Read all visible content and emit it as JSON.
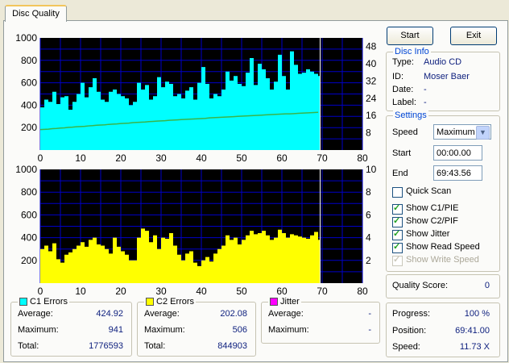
{
  "tab": {
    "label": "Disc Quality"
  },
  "buttons": {
    "start": "Start",
    "exit": "Exit"
  },
  "disc_info": {
    "title": "Disc Info",
    "rows": [
      {
        "label": "Type:",
        "value": "Audio CD"
      },
      {
        "label": "ID:",
        "value": "Moser Baer"
      },
      {
        "label": "Date:",
        "value": "-"
      },
      {
        "label": "Label:",
        "value": "-"
      }
    ]
  },
  "settings": {
    "title": "Settings",
    "speed_label": "Speed",
    "speed_value": "Maximum",
    "start_label": "Start",
    "start_value": "00:00.00",
    "end_label": "End",
    "end_value": "69:43.56",
    "quick_scan": "Quick Scan",
    "show_c1": "Show C1/PIE",
    "show_c2": "Show C2/PIF",
    "show_jitter": "Show Jitter",
    "show_read": "Show Read Speed",
    "show_write": "Show Write Speed"
  },
  "quality": {
    "label": "Quality Score:",
    "value": "0"
  },
  "progress": {
    "progress_label": "Progress:",
    "progress_value": "100 %",
    "position_label": "Position:",
    "position_value": "69:41.00",
    "speed_label": "Speed:",
    "speed_value": "11.73 X"
  },
  "c1": {
    "title": "C1 Errors",
    "avg_label": "Average:",
    "avg": "424.92",
    "max_label": "Maximum:",
    "max": "941",
    "total_label": "Total:",
    "total": "1776593"
  },
  "c2": {
    "title": "C2 Errors",
    "avg_label": "Average:",
    "avg": "202.08",
    "max_label": "Maximum:",
    "max": "506",
    "total_label": "Total:",
    "total": "844903"
  },
  "jitter": {
    "title": "Jitter",
    "avg_label": "Average:",
    "avg": "-",
    "max_label": "Maximum:",
    "max": "-"
  },
  "colors": {
    "c1": "#00ffff",
    "c2": "#ffff00",
    "jitter": "#ff00ff",
    "plot_bg": "#000000",
    "grid": "#0000c8",
    "read_speed": "#39b54a",
    "end_marker": "#ffffff"
  },
  "chart_data": [
    {
      "type": "area",
      "name": "C1 errors",
      "y_ticks_left": [
        "1000",
        "800",
        "600",
        "400",
        "200"
      ],
      "y_ticks_right": [
        "48",
        "40",
        "32",
        "24",
        "16",
        "8"
      ],
      "x_ticks": [
        "0",
        "10",
        "20",
        "30",
        "40",
        "50",
        "60",
        "70",
        "80"
      ],
      "xlim": [
        0,
        80
      ],
      "ylim": [
        0,
        1000
      ],
      "y2lim": [
        0,
        52
      ],
      "x": [
        0,
        1,
        2,
        3,
        4,
        5,
        6,
        7,
        8,
        9,
        10,
        11,
        12,
        13,
        14,
        15,
        16,
        17,
        18,
        19,
        20,
        21,
        22,
        23,
        24,
        25,
        26,
        27,
        28,
        29,
        30,
        31,
        32,
        33,
        34,
        35,
        36,
        37,
        38,
        39,
        40,
        41,
        42,
        43,
        44,
        45,
        46,
        47,
        48,
        49,
        50,
        51,
        52,
        53,
        54,
        55,
        56,
        57,
        58,
        59,
        60,
        61,
        62,
        63,
        64,
        65,
        66,
        67,
        68,
        69
      ],
      "c1_values": [
        380,
        450,
        430,
        520,
        410,
        470,
        480,
        360,
        430,
        500,
        600,
        470,
        560,
        640,
        520,
        450,
        430,
        520,
        540,
        500,
        480,
        460,
        400,
        430,
        600,
        540,
        580,
        450,
        480,
        650,
        560,
        610,
        590,
        480,
        500,
        460,
        530,
        560,
        450,
        600,
        740,
        590,
        460,
        500,
        480,
        540,
        700,
        620,
        660,
        590,
        570,
        690,
        820,
        580,
        770,
        720,
        640,
        540,
        610,
        850,
        660,
        540,
        880,
        760,
        680,
        690,
        720,
        700,
        680,
        660
      ],
      "read_speed": [
        9.5,
        9.6,
        9.7,
        9.9,
        10.0,
        10.2,
        10.3,
        10.5,
        10.6,
        10.8,
        10.9,
        11.0,
        11.2,
        11.3,
        11.5,
        11.6,
        11.7,
        11.9,
        12.0,
        12.1,
        12.3,
        12.4,
        12.5,
        12.7,
        12.8,
        12.9,
        13.0,
        13.2,
        13.3,
        13.4,
        13.5,
        13.6,
        13.8,
        13.9,
        14.0,
        14.1,
        14.2,
        14.3,
        14.4,
        14.5,
        14.6,
        14.7,
        14.9,
        15.0,
        15.1,
        15.2,
        15.3,
        15.4,
        15.5,
        15.6,
        15.7,
        15.8,
        15.9,
        16.0,
        16.1,
        16.2,
        16.3,
        16.4,
        16.5,
        16.6,
        16.7,
        16.8,
        16.8,
        16.9,
        17.0,
        17.1,
        17.2,
        17.3,
        17.4,
        17.5
      ]
    },
    {
      "type": "area",
      "name": "C2 errors",
      "y_ticks_left": [
        "1000",
        "800",
        "600",
        "400",
        "200"
      ],
      "y_ticks_right": [
        "10",
        "8",
        "6",
        "4",
        "2"
      ],
      "x_ticks": [
        "0",
        "10",
        "20",
        "30",
        "40",
        "50",
        "60",
        "70",
        "80"
      ],
      "xlim": [
        0,
        80
      ],
      "ylim": [
        0,
        1000
      ],
      "y2lim": [
        0,
        10
      ],
      "x": [
        0,
        1,
        2,
        3,
        4,
        5,
        6,
        7,
        8,
        9,
        10,
        11,
        12,
        13,
        14,
        15,
        16,
        17,
        18,
        19,
        20,
        21,
        22,
        23,
        24,
        25,
        26,
        27,
        28,
        29,
        30,
        31,
        32,
        33,
        34,
        35,
        36,
        37,
        38,
        39,
        40,
        41,
        42,
        43,
        44,
        45,
        46,
        47,
        48,
        49,
        50,
        51,
        52,
        53,
        54,
        55,
        56,
        57,
        58,
        59,
        60,
        61,
        62,
        63,
        64,
        65,
        66,
        67,
        68,
        69
      ],
      "c2_values": [
        300,
        330,
        280,
        350,
        210,
        180,
        250,
        270,
        300,
        330,
        360,
        320,
        380,
        400,
        340,
        330,
        300,
        260,
        400,
        320,
        280,
        250,
        200,
        200,
        400,
        480,
        460,
        360,
        420,
        300,
        400,
        390,
        440,
        330,
        250,
        200,
        260,
        280,
        180,
        150,
        200,
        230,
        190,
        260,
        300,
        330,
        420,
        380,
        400,
        340,
        380,
        420,
        460,
        430,
        440,
        460,
        420,
        380,
        400,
        470,
        440,
        400,
        430,
        420,
        410,
        400,
        390,
        420,
        450,
        380
      ]
    }
  ]
}
